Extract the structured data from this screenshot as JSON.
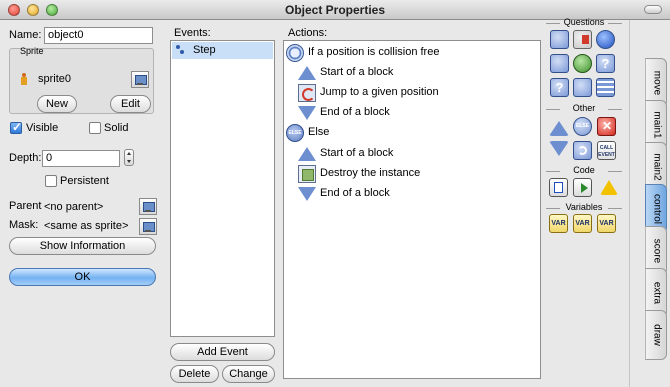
{
  "window": {
    "title": "Object Properties"
  },
  "left": {
    "name_label": "Name:",
    "name_value": "object0",
    "sprite_group_label": "Sprite",
    "sprite_value": "sprite0",
    "new_button": "New",
    "edit_button": "Edit",
    "visible_label": "Visible",
    "visible_checked": true,
    "solid_label": "Solid",
    "solid_checked": false,
    "depth_label": "Depth:",
    "depth_value": "0",
    "persistent_label": "Persistent",
    "persistent_checked": false,
    "parent_label": "Parent",
    "parent_value": "<no parent>",
    "mask_label": "Mask:",
    "mask_value": "<same as sprite>",
    "show_info_button": "Show Information",
    "ok_button": "OK"
  },
  "events": {
    "header": "Events:",
    "items": [
      {
        "label": "Step",
        "icon": "step-icon",
        "selected": true
      }
    ],
    "add_button": "Add Event",
    "delete_button": "Delete",
    "change_button": "Change"
  },
  "actions": {
    "header": "Actions:",
    "items": [
      {
        "label": "If a position is collision free",
        "icon": "collision-free-icon",
        "indent": 0
      },
      {
        "label": "Start of a block",
        "icon": "start-block-icon",
        "indent": 1
      },
      {
        "label": "Jump to a given position",
        "icon": "jump-position-icon",
        "indent": 1
      },
      {
        "label": "End of a block",
        "icon": "end-block-icon",
        "indent": 1
      },
      {
        "label": "Else",
        "icon": "else-icon",
        "indent": 0
      },
      {
        "label": "Start of a block",
        "icon": "start-block-icon",
        "indent": 1
      },
      {
        "label": "Destroy the instance",
        "icon": "destroy-instance-icon",
        "indent": 1
      },
      {
        "label": "End of a block",
        "icon": "end-block-icon",
        "indent": 1
      }
    ]
  },
  "palette": {
    "questions_header": "Questions",
    "other_header": "Other",
    "code_header": "Code",
    "variables_header": "Variables",
    "else_icon_text": "ELSE",
    "call_event_text": "CALL EVENT",
    "var_text": "VAR",
    "question_text": "?"
  },
  "tabs": [
    "move",
    "main1",
    "main2",
    "control",
    "score",
    "extra",
    "draw"
  ],
  "active_tab": "control"
}
